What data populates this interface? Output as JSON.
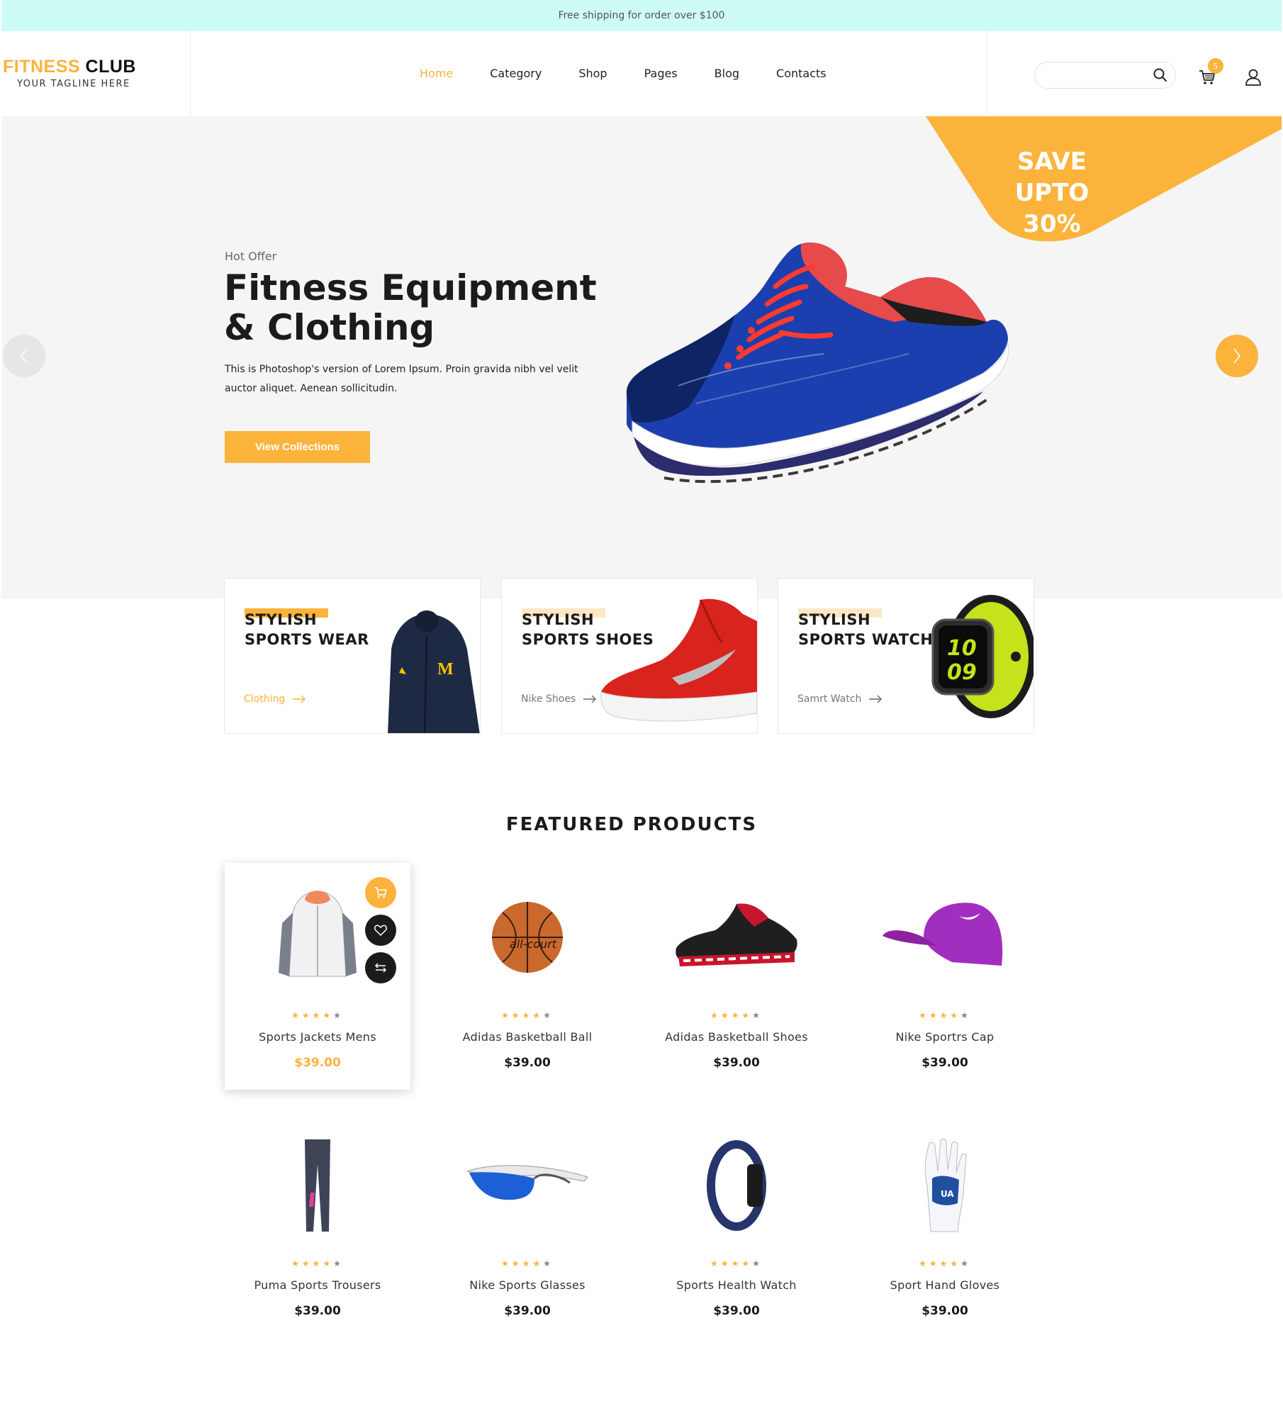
{
  "topbar": {
    "text": "Free shipping for order over $100"
  },
  "logo": {
    "word1": "FITNESS",
    "word2": "CLUB",
    "tagline": "YOUR TAGLINE HERE"
  },
  "nav": [
    {
      "label": "Home",
      "active": true
    },
    {
      "label": "Category"
    },
    {
      "label": "Shop"
    },
    {
      "label": "Pages"
    },
    {
      "label": "Blog"
    },
    {
      "label": "Contacts"
    }
  ],
  "search": {
    "placeholder": "",
    "value": ""
  },
  "cart": {
    "count": "5"
  },
  "hero": {
    "promo_line1": "SAVE UPTO",
    "promo_line2": "30%",
    "kicker": "Hot Offer",
    "title_line1": "Fitness Equipment",
    "title_line2": "& Clothing",
    "desc_line1": "This is Photoshop's version  of Lorem Ipsum. Proin gravida nibh vel velit",
    "desc_line2": "auctor aliquet. Aenean sollicitudin.",
    "button": "View Collections"
  },
  "categories": [
    {
      "line1": "STYLISH",
      "line2": "SPORTS WEAR",
      "link": "Clothing",
      "accent": true
    },
    {
      "line1": "STYLISH",
      "line2": "SPORTS SHOES",
      "link": "Nike Shoes",
      "accent": false
    },
    {
      "line1": "STYLISH",
      "line2": "SPORTS WATCH",
      "link": "Samrt Watch",
      "accent": false
    }
  ],
  "featured": {
    "title": "FEATURED PRODUCTS",
    "products": [
      {
        "name": "Sports Jackets Mens",
        "price": "$39.00",
        "rating": 4,
        "icon": "jacket-icon"
      },
      {
        "name": "Adidas Basketball Ball",
        "price": "$39.00",
        "rating": 4,
        "icon": "basketball-icon"
      },
      {
        "name": "Adidas Basketball Shoes",
        "price": "$39.00",
        "rating": 4,
        "icon": "sneaker-icon"
      },
      {
        "name": "Nike Sportrs Cap",
        "price": "$39.00",
        "rating": 4,
        "icon": "cap-icon"
      },
      {
        "name": "Puma Sports Trousers",
        "price": "$39.00",
        "rating": 4,
        "icon": "trousers-icon"
      },
      {
        "name": "Nike Sports Glasses",
        "price": "$39.00",
        "rating": 4,
        "icon": "glasses-icon"
      },
      {
        "name": "Sports Health Watch",
        "price": "$39.00",
        "rating": 4,
        "icon": "fitness-band-icon"
      },
      {
        "name": "Sport Hand Gloves",
        "price": "$39.00",
        "rating": 4,
        "icon": "glove-icon"
      }
    ]
  },
  "colors": {
    "accent": "#fbb33c",
    "topbar": "#cdfbf5",
    "hero_bg": "#f5f5f5"
  }
}
